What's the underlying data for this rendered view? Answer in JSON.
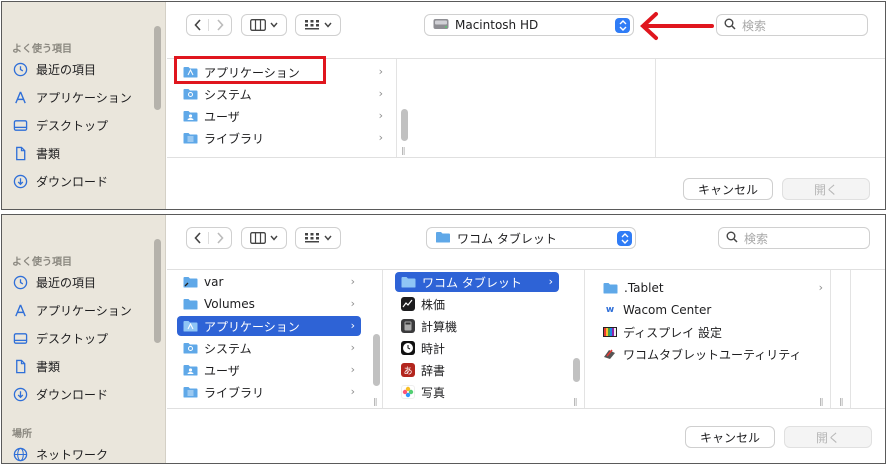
{
  "sidebar": {
    "favorites_heading": "よく使う項目",
    "items": [
      {
        "label": "最近の項目",
        "icon": "clock-icon"
      },
      {
        "label": "アプリケーション",
        "icon": "applications-icon"
      },
      {
        "label": "デスクトップ",
        "icon": "desktop-icon"
      },
      {
        "label": "書類",
        "icon": "document-icon"
      },
      {
        "label": "ダウンロード",
        "icon": "download-icon"
      }
    ],
    "locations_heading": "場所",
    "network_label": "ネットワーク"
  },
  "dialog1": {
    "location": "Macintosh HD",
    "search_placeholder": "検索",
    "column1": [
      "アプリケーション",
      "システム",
      "ユーザ",
      "ライブラリ"
    ],
    "cancel": "キャンセル",
    "open": "開く"
  },
  "dialog2": {
    "location": "ワコム タブレット",
    "search_placeholder": "検索",
    "column1": [
      "var",
      "Volumes",
      "アプリケーション",
      "システム",
      "ユーザ",
      "ライブラリ"
    ],
    "column2": [
      "ワコム タブレット",
      "株価",
      "計算機",
      "時計",
      "辞書",
      "写真"
    ],
    "column3": [
      ".Tablet",
      "Wacom Center",
      "ディスプレイ 設定",
      "ワコムタブレットユーティリティ"
    ],
    "cancel": "キャンセル",
    "open": "開く"
  },
  "colors": {
    "selection": "#2e63d6",
    "accent": "#2f7cf6",
    "annotation": "#e0161e"
  }
}
